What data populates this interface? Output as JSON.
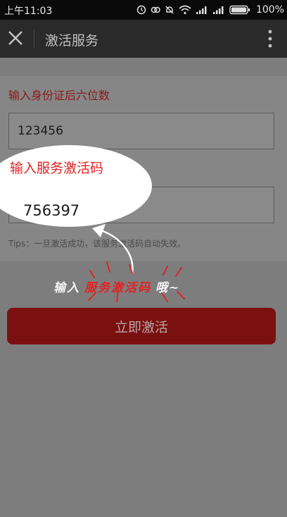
{
  "status_bar": {
    "time": "上午11:03",
    "battery": "100%",
    "icons": [
      "alarm-icon",
      "circles-icon",
      "mute-bell-icon",
      "wifi-icon",
      "signal-icon",
      "signal-icon",
      "battery-icon"
    ]
  },
  "header": {
    "title": "激活服务",
    "close_icon": "close-icon",
    "more_icon": "more-vert-icon"
  },
  "form": {
    "id_label": "输入身份证后六位数",
    "id_value": "123456",
    "code_value": "756397",
    "tips": "Tips：一旦激活成功，该服务激活码自动失效。"
  },
  "overlay": {
    "bubble_label": "输入服务激活码",
    "bubble_value": "756397",
    "note_prefix": "输入",
    "note_highlight": "服务激活码",
    "note_suffix": "哦~"
  },
  "action": {
    "activate_label": "立即激活"
  },
  "colors": {
    "accent_red": "#e02424",
    "button_red": "#7a1010",
    "header_bg": "#2a2a2a",
    "overlay_bg": "#7d7d7d"
  }
}
